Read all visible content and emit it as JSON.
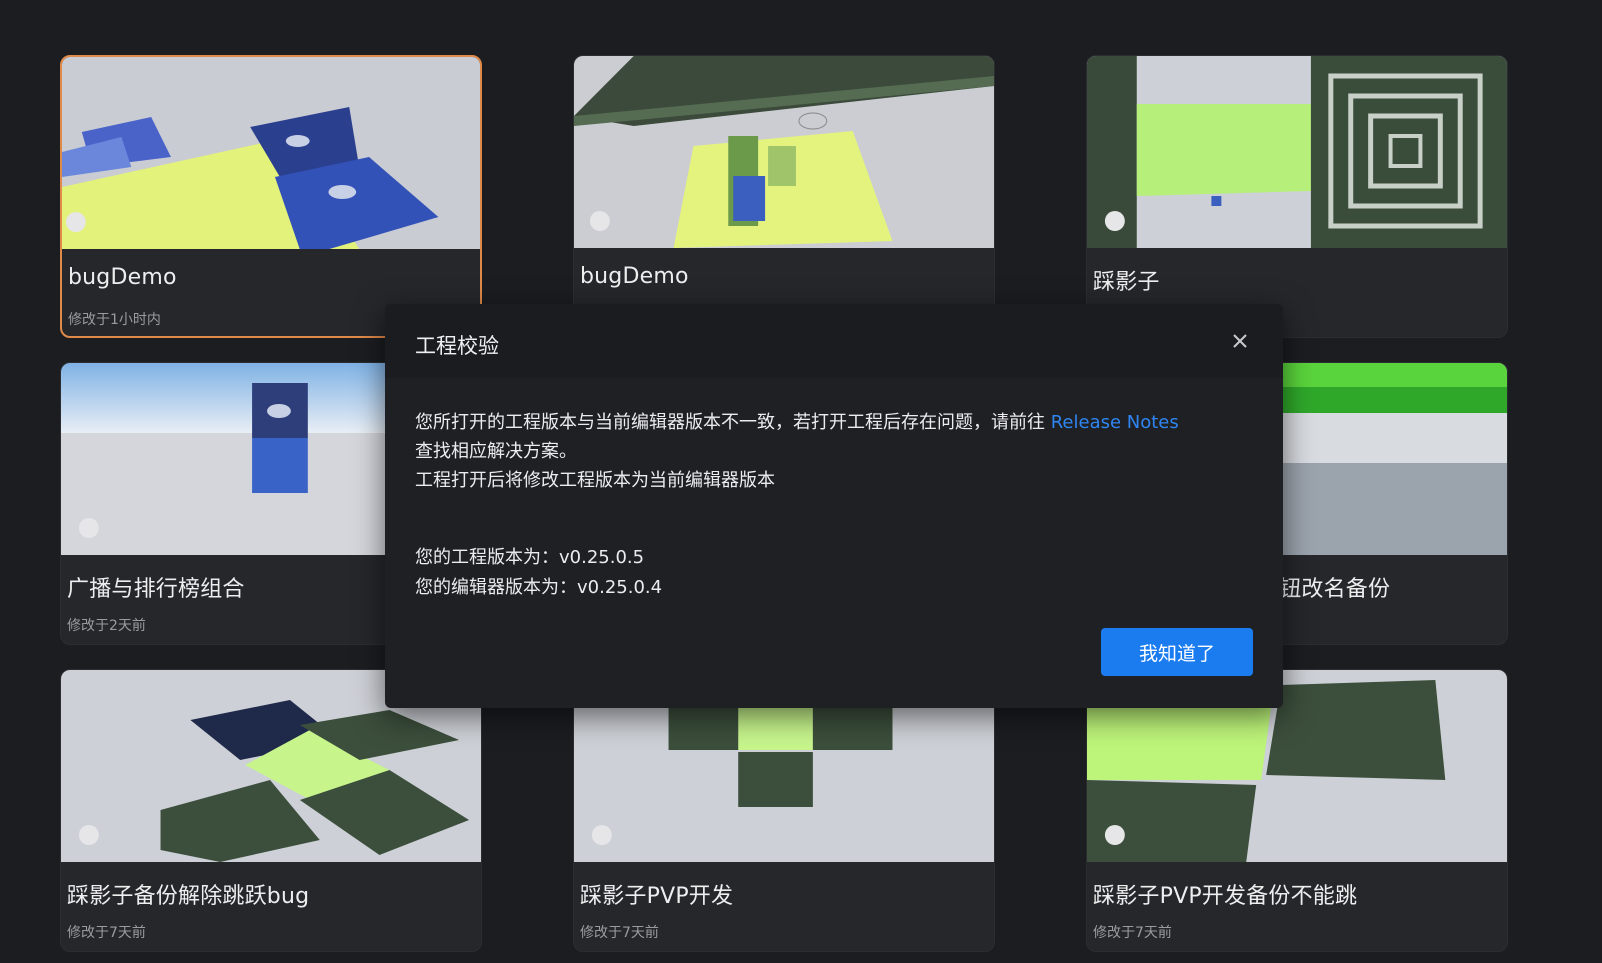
{
  "projects": [
    {
      "title": "bugDemo",
      "modified": "修改于1小时内",
      "selected": true
    },
    {
      "title": "bugDemo",
      "modified": ""
    },
    {
      "title": "踩影子",
      "modified": ""
    },
    {
      "title": "广播与排行榜组合",
      "modified": "修改于2天前"
    },
    {
      "title": "",
      "modified": ""
    },
    {
      "title": "按钮改名备份",
      "modified": ""
    },
    {
      "title": "踩影子备份解除跳跃bug",
      "modified": "修改于7天前"
    },
    {
      "title": "踩影子PVP开发",
      "modified": "修改于7天前"
    },
    {
      "title": "踩影子PVP开发备份不能跳",
      "modified": "修改于7天前"
    }
  ],
  "dialog": {
    "title": "工程校验",
    "message_line1": "您所打开的工程版本与当前编辑器版本不一致，若打开工程后存在问题，请前往 ",
    "link_text": "Release Notes",
    "message_line2": "查找相应解决方案。",
    "message_line3": "工程打开后将修改工程版本为当前编辑器版本",
    "project_version": "您的工程版本为：v0.25.0.5",
    "editor_version": "您的编辑器版本为：v0.25.0.4",
    "confirm_label": "我知道了",
    "close_icon": "close-icon"
  },
  "colors": {
    "background": "#1c1d21",
    "card": "#26272b",
    "selected_border": "#e08a4a",
    "accent": "#1b7cf0",
    "link": "#2f86f2"
  }
}
